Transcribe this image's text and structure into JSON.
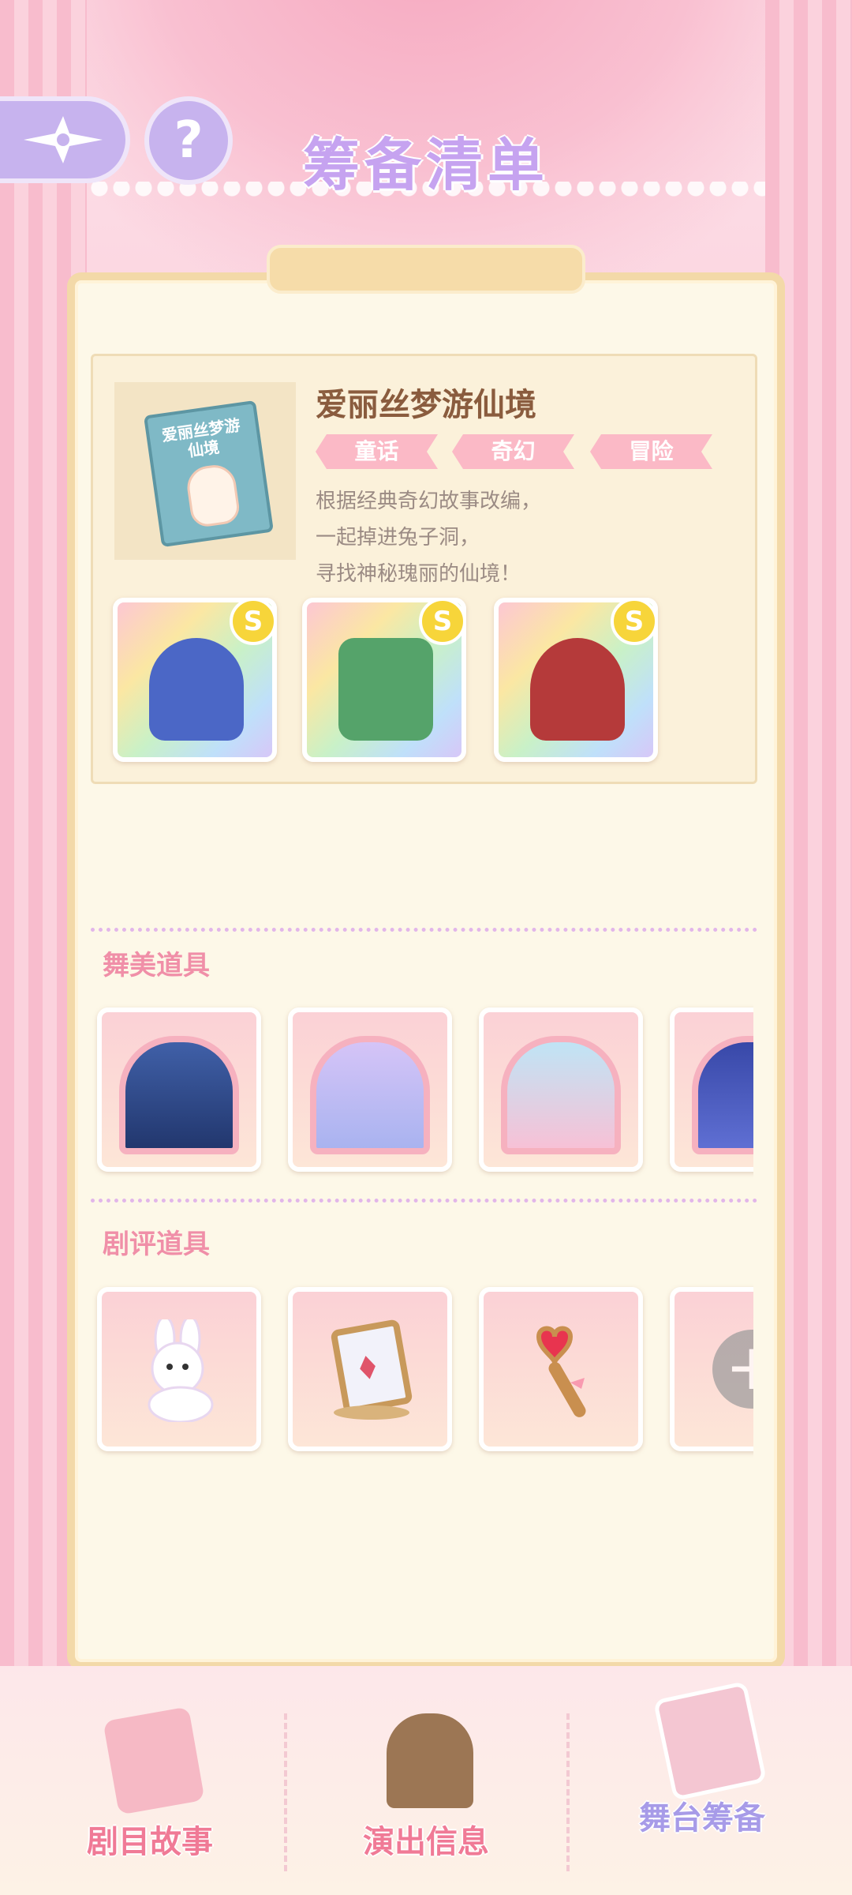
{
  "header": {
    "title": "筹备清单",
    "help_label": "?"
  },
  "book": {
    "cover_title": "爱丽丝梦游仙境",
    "title": "爱丽丝梦游仙境",
    "tags": [
      "童话",
      "奇幻",
      "冒险"
    ],
    "description": [
      "根据经典奇幻故事改编，",
      "一起掉进兔子洞，",
      "寻找神秘瑰丽的仙境！"
    ],
    "costumes": [
      {
        "name": "blue-dress",
        "coin": "S"
      },
      {
        "name": "green-jacket",
        "coin": "S"
      },
      {
        "name": "rabbit-hat",
        "coin": "S"
      }
    ]
  },
  "sections": {
    "stage_props_title": "舞美道具",
    "review_props_title": "剧评道具",
    "review_add_label": "+"
  },
  "bottom_nav": {
    "items": [
      {
        "label": "剧目故事",
        "icon": "story-book-icon"
      },
      {
        "label": "演出信息",
        "icon": "info-board-icon"
      },
      {
        "label": "舞台筹备",
        "icon": "clipboard-icon",
        "active": true
      }
    ]
  },
  "colors": {
    "accent_purple": "#c6a3f0",
    "accent_pink": "#f08fa8",
    "tag_pink": "#fbb9c6",
    "coin_gold": "#f7d53a"
  }
}
